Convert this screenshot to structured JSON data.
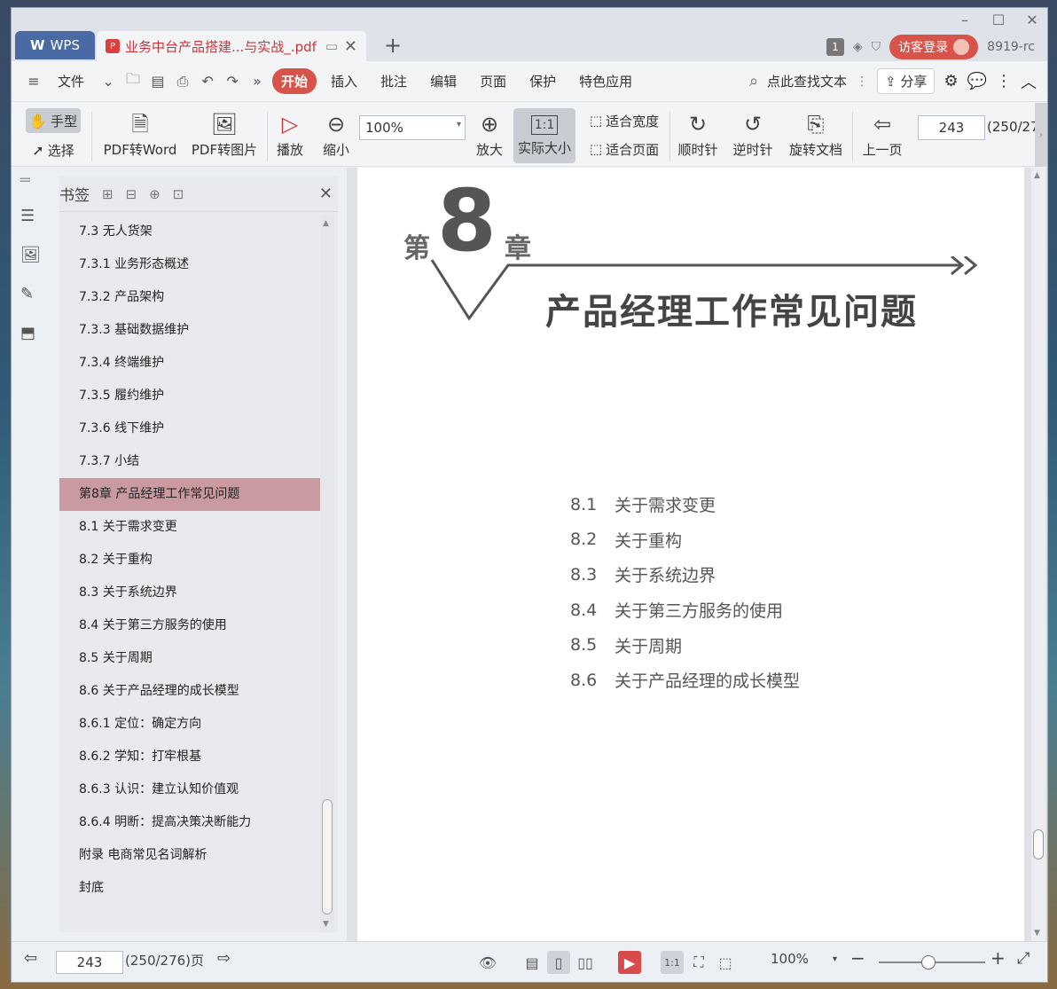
{
  "titlebar": {
    "wps_tab": "WPS",
    "doc_tab": "业务中台产品搭建...与实战_.pdf",
    "page_badge": "1",
    "login": "访客登录",
    "version": "8919-rc"
  },
  "menubar": {
    "file": "文件",
    "items": [
      "开始",
      "插入",
      "批注",
      "编辑",
      "页面",
      "保护",
      "特色应用"
    ],
    "search": "点此查找文本",
    "share": "分享"
  },
  "toolbar": {
    "hand": "手型",
    "select": "选择",
    "pdf_to_word": "PDF转Word",
    "pdf_to_image": "PDF转图片",
    "play": "播放",
    "zoom_out": "缩小",
    "zoom_value": "100%",
    "zoom_in": "放大",
    "actual_size": "实际大小",
    "fit_width": "适合宽度",
    "fit_page": "适合页面",
    "clockwise": "顺时针",
    "counterclockwise": "逆时针",
    "rotate_doc": "旋转文档",
    "prev_page": "上一页",
    "page_input": "243",
    "page_total": "(250/27"
  },
  "bookmarks": {
    "title": "书签",
    "items": [
      "7.3  无人货架",
      "7.3.1  业务形态概述",
      "7.3.2  产品架构",
      "7.3.3  基础数据维护",
      "7.3.4  终端维护",
      "7.3.5  履约维护",
      "7.3.6  线下维护",
      "7.3.7  小结",
      "第8章  产品经理工作常见问题",
      "8.1  关于需求变更",
      "8.2  关于重构",
      "8.3  关于系统边界",
      "8.4  关于第三方服务的使用",
      "8.5  关于周期",
      "8.6  关于产品经理的成长模型",
      "8.6.1  定位：确定方向",
      "8.6.2  学知：打牢根基",
      "8.6.3  认识：建立认知价值观",
      "8.6.4  明断：提高决策决断能力",
      "附录  电商常见名词解析",
      "封底"
    ],
    "selected_index": 8
  },
  "page": {
    "chapter_prefix": "第",
    "chapter_number": "8",
    "chapter_suffix": "章",
    "chapter_title": "产品经理工作常见问题",
    "toc": [
      {
        "num": "8.1",
        "title": "关于需求变更"
      },
      {
        "num": "8.2",
        "title": "关于重构"
      },
      {
        "num": "8.3",
        "title": "关于系统边界"
      },
      {
        "num": "8.4",
        "title": "关于第三方服务的使用"
      },
      {
        "num": "8.5",
        "title": "关于周期"
      },
      {
        "num": "8.6",
        "title": "关于产品经理的成长模型"
      }
    ]
  },
  "statusbar": {
    "page_input": "243",
    "page_count": "(250/276)页",
    "zoom": "100%"
  },
  "colors": {
    "accent": "#d8544b",
    "selected_bookmark": "#c99ba1",
    "wps_tab": "#4a6aa5"
  }
}
